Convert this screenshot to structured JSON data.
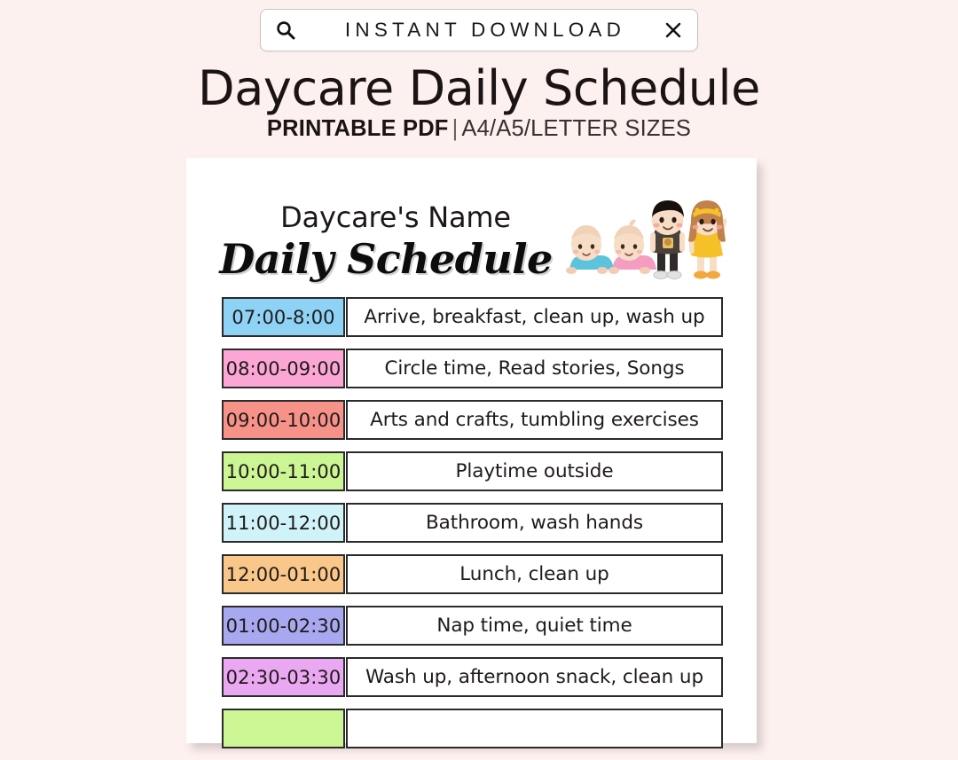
{
  "colors": {
    "page_background": "#FDF1F0",
    "card_background": "#FFFFFF",
    "border": "#2B2B2B",
    "text": "#1F1A1A"
  },
  "top_bar": {
    "label": "INSTANT DOWNLOAD",
    "search_icon": "search-icon",
    "close_icon": "close-icon"
  },
  "headline": {
    "title": "Daycare Daily Schedule",
    "subtitle_strong": "PRINTABLE PDF",
    "subtitle_divider": "|",
    "subtitle_rest": "A4/A5/LETTER SIZES"
  },
  "card": {
    "daycare_name": "Daycare's Name",
    "script_title": "Daily Schedule",
    "illustration": "children-illustration",
    "rows": [
      {
        "time": "07:00-8:00",
        "activity": "Arrive, breakfast, clean up, wash up",
        "color": "#8ED2F5"
      },
      {
        "time": "08:00-09:00",
        "activity": "Circle time, Read stories, Songs",
        "color": "#FBA6D4"
      },
      {
        "time": "09:00-10:00",
        "activity": "Arts and crafts, tumbling exercises",
        "color": "#F79289"
      },
      {
        "time": "10:00-11:00",
        "activity": "Playtime outside",
        "color": "#CCF593"
      },
      {
        "time": "11:00-12:00",
        "activity": "Bathroom, wash hands",
        "color": "#CFF3F8"
      },
      {
        "time": "12:00-01:00",
        "activity": "Lunch, clean up",
        "color": "#F9C78A"
      },
      {
        "time": "01:00-02:30",
        "activity": "Nap time, quiet time",
        "color": "#A8A8F0"
      },
      {
        "time": "02:30-03:30",
        "activity": "Wash up, afternoon snack, clean up",
        "color": "#EAA8F2"
      },
      {
        "time": "",
        "activity": "",
        "color": "#CCF593"
      }
    ]
  }
}
